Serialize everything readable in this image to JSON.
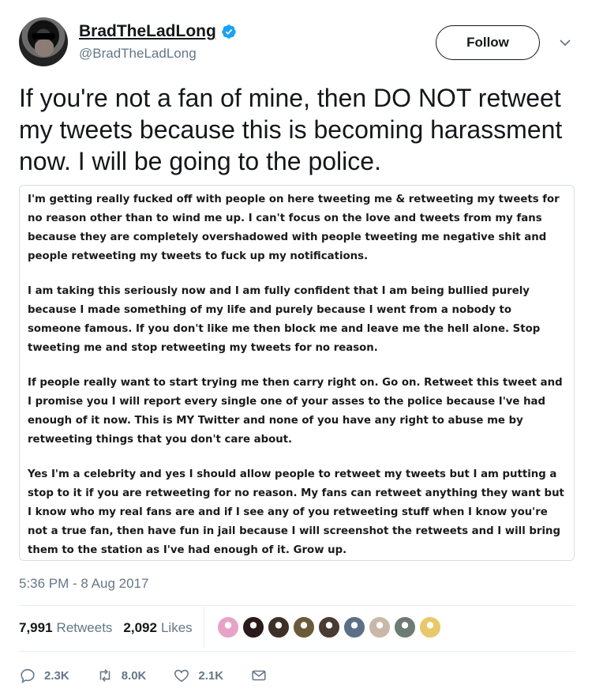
{
  "user": {
    "display_name": "BradTheLadLong",
    "handle": "@BradTheLadLong",
    "verified": true
  },
  "follow_label": "Follow",
  "tweet_text": "If you're not a fan of mine, then DO NOT retweet my tweets because this is becoming harassment now. I will be going to the police.",
  "attached_image_text": {
    "paragraphs": [
      "I'm getting really fucked off with people on here tweeting me & retweeting my tweets for no reason other than to wind me up. I can't focus on the love and tweets from my fans because they are completely overshadowed with people tweeting me negative shit and people retweeting my tweets to fuck up my notifications.",
      "I am taking this seriously now and I am fully confident that I am being bullied purely because I made something of my life and purely because I went from a nobody to someone famous. If you don't like me then block me and leave me the hell alone. Stop tweeting me and stop retweeting my tweets for no reason.",
      "If people really want to start trying me then carry right on. Go on. Retweet this tweet and I promise you I will report every single one of your asses to the police because I've had enough of it now. This is MY Twitter and none of you have any right to abuse me by retweeting things that you don't care about.",
      "Yes I'm a celebrity and yes I should allow people to retweet my tweets but I am putting a stop to it if you are retweeting for no reason. My fans can retweet anything they want but I know who my real fans are and if I see any of you retweeting stuff when I know you're not a true fan, then have fun in jail because I will screenshot the retweets and I will bring them to the station as I've had enough of it. Grow up."
    ]
  },
  "timestamp": "5:36 PM - 8 Aug 2017",
  "stats": {
    "retweets_count": "7,991",
    "retweets_label": "Retweets",
    "likes_count": "2,092",
    "likes_label": "Likes"
  },
  "liker_avatar_colors": [
    "#e7a3c6",
    "#2b1a1a",
    "#3d3026",
    "#6b5a3a",
    "#4a3b34",
    "#5d6f86",
    "#c9b8a8",
    "#6e7a74",
    "#e8c86a"
  ],
  "actions": {
    "reply_count": "2.3K",
    "retweet_count": "8.0K",
    "like_count": "2.1K"
  },
  "colors": {
    "text_primary": "#14171a",
    "text_secondary": "#657786",
    "verified_blue": "#1da1f2",
    "border": "#e6ecf0"
  }
}
